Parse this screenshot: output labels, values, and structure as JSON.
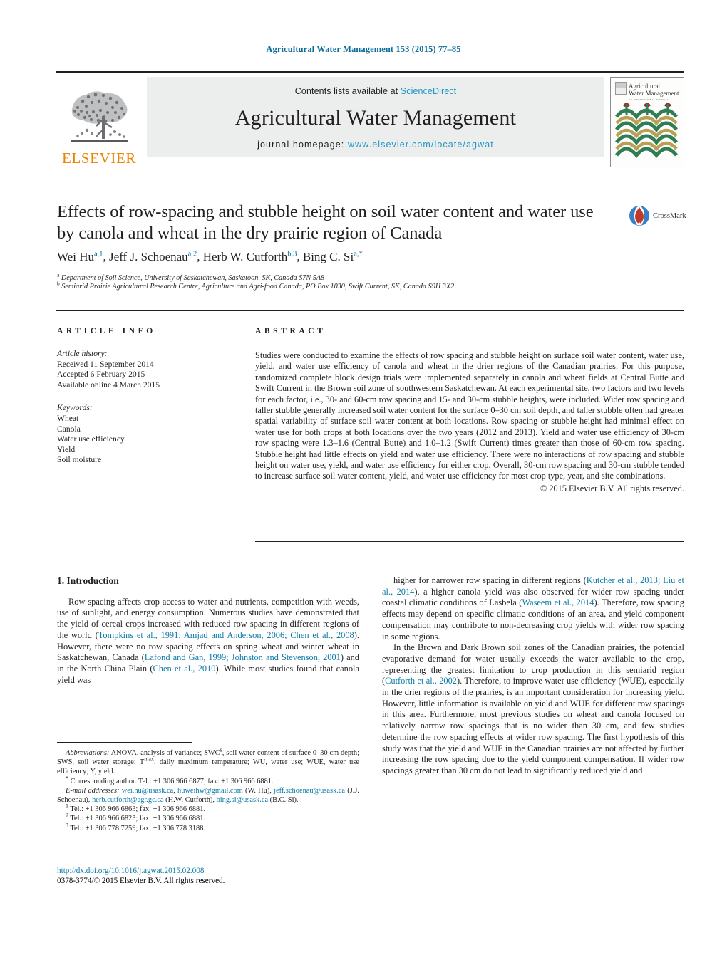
{
  "running_head": "Agricultural Water Management 153 (2015) 77–85",
  "banner": {
    "publisher": "ELSEVIER",
    "contents_prefix": "Contents lists available at ",
    "contents_link": "ScienceDirect",
    "journal_title": "Agricultural Water Management",
    "homepage_prefix": "journal homepage: ",
    "homepage_url": "www.elsevier.com/locate/agwat",
    "cover_title_line1": "Agricultural",
    "cover_title_line2": "Water Management",
    "cover_subtitle": "AN INTERNATIONAL JOURNAL"
  },
  "article": {
    "title": "Effects of row-spacing and stubble height on soil water content and water use by canola and wheat in the dry prairie region of Canada",
    "crossmark_label": "CrossMark",
    "authors_html": "Wei Hu<sup>a,1</sup>, Jeff J. Schoenau<sup>a,2</sup>, Herb W. Cutforth<sup>b,3</sup>, Bing C. Si<sup>a,*</sup>",
    "affiliation_a": "Department of Soil Science, University of Saskatchewan, Saskatoon, SK, Canada S7N 5A8",
    "affiliation_b": "Semiarid Prairie Agricultural Research Centre, Agriculture and Agri-food Canada, PO Box 1030, Swift Current, SK, Canada S9H 3X2"
  },
  "info": {
    "heading": "ARTICLE INFO",
    "history_label": "Article history:",
    "history": [
      "Received 11 September 2014",
      "Accepted 6 February 2015",
      "Available online 4 March 2015"
    ],
    "keywords_label": "Keywords:",
    "keywords": [
      "Wheat",
      "Canola",
      "Water use efficiency",
      "Yield",
      "Soil moisture"
    ]
  },
  "abstract": {
    "heading": "ABSTRACT",
    "text": "Studies were conducted to examine the effects of row spacing and stubble height on surface soil water content, water use, yield, and water use efficiency of canola and wheat in the drier regions of the Canadian prairies. For this purpose, randomized complete block design trials were implemented separately in canola and wheat fields at Central Butte and Swift Current in the Brown soil zone of southwestern Saskatchewan. At each experimental site, two factors and two levels for each factor, i.e., 30- and 60-cm row spacing and 15- and 30-cm stubble heights, were included. Wider row spacing and taller stubble generally increased soil water content for the surface 0–30 cm soil depth, and taller stubble often had greater spatial variability of surface soil water content at both locations. Row spacing or stubble height had minimal effect on water use for both crops at both locations over the two years (2012 and 2013). Yield and water use efficiency of 30-cm row spacing were 1.3–1.6 (Central Butte) and 1.0–1.2 (Swift Current) times greater than those of 60-cm row spacing. Stubble height had little effects on yield and water use efficiency. There were no interactions of row spacing and stubble height on water use, yield, and water use efficiency for either crop. Overall, 30-cm row spacing and 30-cm stubble tended to increase surface soil water content, yield, and water use efficiency for most crop type, year, and site combinations.",
    "copyright": "© 2015 Elsevier B.V. All rights reserved."
  },
  "introduction": {
    "heading": "1.  Introduction",
    "left_para_1_html": "Row spacing affects crop access to water and nutrients, competition with weeds, use of sunlight, and energy consumption. Numerous studies have demonstrated that the yield of cereal crops increased with reduced row spacing in different regions of the world (<span class=\"ref\">Tompkins et al., 1991; Amjad and Anderson, 2006; Chen et al., 2008</span>). However, there were no row spacing effects on spring wheat and winter wheat in Saskatchewan, Canada (<span class=\"ref\">Lafond and Gan, 1999; Johnston and Stevenson, 2001</span>) and in the North China Plain (<span class=\"ref\">Chen et al., 2010</span>). While most studies found that canola yield was",
    "right_para_1_html": "higher for narrower row spacing in different regions (<span class=\"ref\">Kutcher et al., 2013; Liu et al., 2014</span>), a higher canola yield was also observed for wider row spacing under coastal climatic conditions of Lasbela (<span class=\"ref\">Waseem et al., 2014</span>). Therefore, row spacing effects may depend on specific climatic conditions of an area, and yield component compensation may contribute to non-decreasing crop yields with wider row spacing in some regions.",
    "right_para_2_html": "In the Brown and Dark Brown soil zones of the Canadian prairies, the potential evaporative demand for water usually exceeds the water available to the crop, representing the greatest limitation to crop production in this semiarid region (<span class=\"ref\">Cutforth et al., 2002</span>). Therefore, to improve water use efficiency (WUE), especially in the drier regions of the prairies, is an important consideration for increasing yield. However, little information is available on yield and WUE for different row spacings in this area. Furthermore, most previous studies on wheat and canola focused on relatively narrow row spacings that is no wider than 30 cm, and few studies determine the row spacing effects at wider row spacing. The first hypothesis of this study was that the yield and WUE in the Canadian prairies are not affected by further increasing the row spacing due to the yield component compensation. If wider row spacings greater than 30 cm do not lead to significantly reduced yield and"
  },
  "footnotes": {
    "abbreviations_html": "<span class=\"fn-ital\">Abbreviations:</span> ANOVA, analysis of variance; SWC<span class=\"fn-mark\">s</span>, soil water content of surface 0–30 cm depth; SWS, soil water storage; T<span class=\"fn-mark\">max</span>, daily maximum temperature; WU, water use; WUE, water use efficiency; Y, yield.",
    "corresponding_html": "<span class=\"fn-mark\">*</span> Corresponding author. Tel.: +1 306 966 6877; fax: +1 306 966 6881.",
    "emails_html": "<span class=\"fn-ital\">E-mail addresses:</span> <span class=\"mail\">wei.hu@usask.ca</span>, <span class=\"mail\">huweihw@gmail.com</span> (W. Hu), <span class=\"mail\">jeff.schoenau@usask.ca</span> (J.J. Schoenau), <span class=\"mail\">herb.cutforth@agr.gc.ca</span> (H.W. Cutforth), <span class=\"mail\">bing.si@usask.ca</span> (B.C. Si).",
    "note_1_html": "<span class=\"fn-mark\">1</span> Tel.: +1 306 966 6863; fax: +1 306 966 6881.",
    "note_2_html": "<span class=\"fn-mark\">2</span> Tel.: +1 306 966 6823; fax: +1 306 966 6881.",
    "note_3_html": "<span class=\"fn-mark\">3</span> Tel.: +1 306 778 7259; fax: +1 306 778 3188."
  },
  "doi": {
    "link": "http://dx.doi.org/10.1016/j.agwat.2015.02.008",
    "issn_line": "0378-3774/© 2015 Elsevier B.V. All rights reserved."
  },
  "colors": {
    "link_blue": "#0b7ba8",
    "header_blue": "#0b6c9a",
    "sciencedirect_blue": "#2196c4",
    "elsevier_orange": "#ef8200",
    "banner_grey": "#eceded",
    "cover_green": "#2e7d55",
    "cover_gold": "#b8a055",
    "cover_red": "#9e2a2b"
  }
}
